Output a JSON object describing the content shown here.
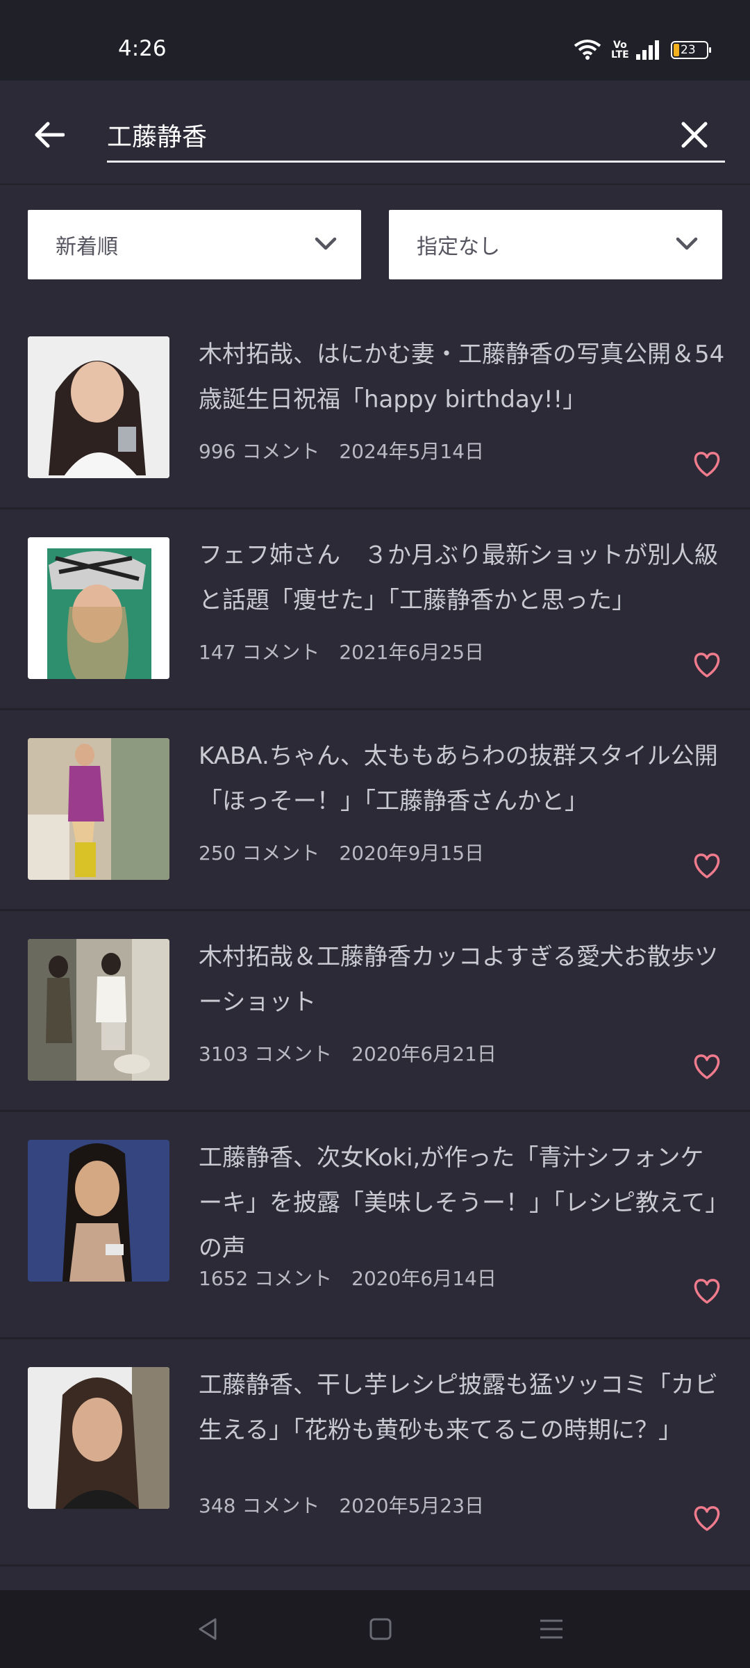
{
  "status_bar": {
    "time": "4:26",
    "battery": "23",
    "volte": "Vo\nLTE"
  },
  "search": {
    "query": "工藤静香"
  },
  "filters": {
    "sort_label": "新着順",
    "filter_label": "指定なし"
  },
  "colors": {
    "heart": "#f07b8d",
    "background": "#2b2a36"
  },
  "articles": [
    {
      "title": "木村拓哉、はにかむ妻・工藤静香の写真公開＆54歳誕生日祝福「happy birthday!!」",
      "meta": "996 コメント　2024年5月14日"
    },
    {
      "title": "フェフ姉さん　３か月ぶり最新ショットが別人級と話題「痩せた」「工藤静香かと思った」",
      "meta": "147 コメント　2021年6月25日"
    },
    {
      "title": "KABA.ちゃん、太ももあらわの抜群スタイル公開「ほっそー！」「工藤静香さんかと」",
      "meta": "250 コメント　2020年9月15日"
    },
    {
      "title": "木村拓哉＆工藤静香カッコよすぎる愛犬お散歩ツーショット",
      "meta": "3103 コメント　2020年6月21日"
    },
    {
      "title": "工藤静香、次女Koki,が作った「青汁シフォンケーキ」を披露「美味しそうー！」「レシピ教えて」の声",
      "meta": "1652 コメント　2020年6月14日"
    },
    {
      "title": "工藤静香、干し芋レシピ披露も猛ツッコミ「カビ生える」「花粉も黄砂も来てるこの時期に？」",
      "meta": "348 コメント　2020年5月23日"
    }
  ]
}
